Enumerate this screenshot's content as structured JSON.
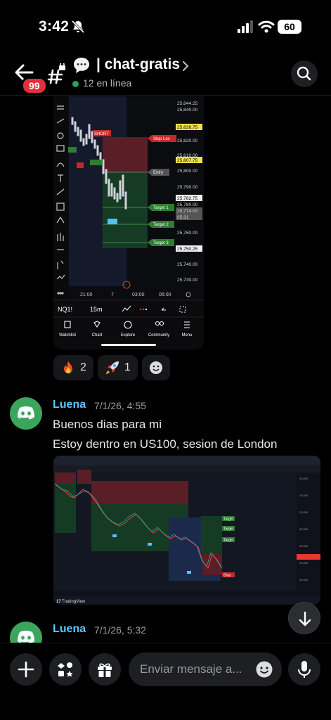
{
  "status": {
    "time": "3:42",
    "battery": "60"
  },
  "header": {
    "unread_badge": "99",
    "channel_name": "| chat-gratis",
    "online_text": "12 en línea"
  },
  "screenshot1": {
    "price_labels": [
      "25,844.25",
      "25,840.00",
      "25,828.75",
      "25,820.00",
      "25,810.00",
      "25,807.75",
      "25,800.00",
      "25,790.00",
      "25,782.75",
      "25,780.00",
      "25,774.00",
      "05:31",
      "25,770.00",
      "25,760.00",
      "25,750.25",
      "25,740.00",
      "25,730.00"
    ],
    "tags": [
      "Stop Los",
      "Entry",
      "Target 1",
      "Target 2",
      "Target 3",
      "SHORT",
      "NQ",
      "NQ",
      "SHORT"
    ],
    "time_axis": [
      "21:00",
      "7",
      "03:00",
      "06:00"
    ],
    "symbol": "NQ1!",
    "interval": "15m",
    "nav": [
      "Watchlist",
      "Chart",
      "Explore",
      "Community",
      "Menu"
    ]
  },
  "reactions": [
    {
      "emoji": "fire-icon",
      "count": "2"
    },
    {
      "emoji": "rocket-icon",
      "count": "1"
    }
  ],
  "messages": [
    {
      "author": "Luena",
      "timestamp": "7/1/26, 4:55",
      "lines": [
        "Buenos dias para mi",
        "Estoy dentro en US100, sesion de London"
      ]
    },
    {
      "author": "Luena",
      "timestamp": "7/1/26, 5:32",
      "lines": []
    }
  ],
  "screenshot2": {
    "brand": "TradingView",
    "tags": [
      "Target",
      "Target",
      "Target",
      "Stop"
    ]
  },
  "composer": {
    "placeholder": "Enviar mensaje a..."
  },
  "colors": {
    "accent_name": "#5ac8fa",
    "online": "#23a55a",
    "badge": "#e0313a",
    "discord": "#3ba55c"
  }
}
